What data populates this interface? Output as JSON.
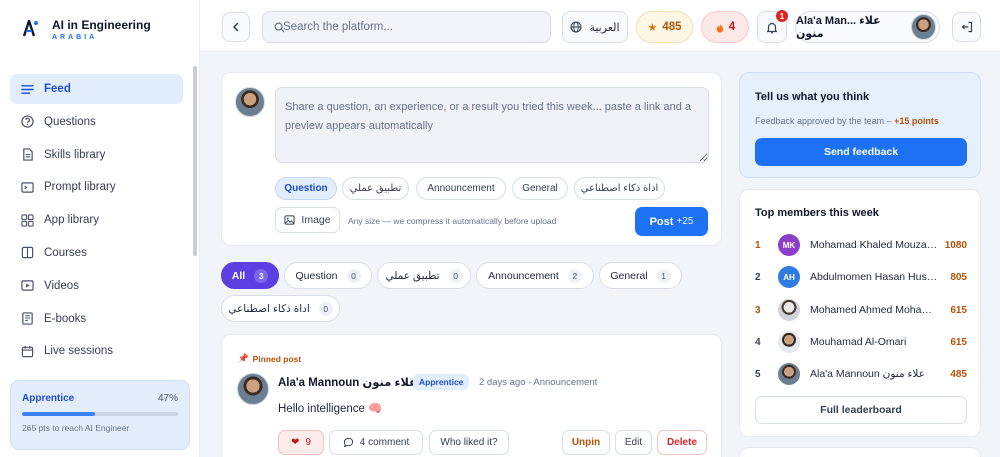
{
  "app": {
    "title": "AI in Engineering",
    "subtitle": "ARABIA"
  },
  "sidebar": {
    "items": [
      {
        "label": "Feed",
        "icon": "feed-icon",
        "active": true
      },
      {
        "label": "Questions",
        "icon": "question-icon"
      },
      {
        "label": "Skills library",
        "icon": "document-icon"
      },
      {
        "label": "Prompt library",
        "icon": "terminal-icon"
      },
      {
        "label": "App library",
        "icon": "apps-icon"
      },
      {
        "label": "Courses",
        "icon": "book-icon"
      },
      {
        "label": "Videos",
        "icon": "video-icon"
      },
      {
        "label": "E-books",
        "icon": "ebook-icon"
      },
      {
        "label": "Live sessions",
        "icon": "calendar-icon"
      }
    ],
    "progress": {
      "level": "Apprentice",
      "percent": "47%",
      "fraction": 0.47,
      "note": "265 pts to reach AI Engineer"
    }
  },
  "topbar": {
    "search_placeholder": "Search the platform...",
    "language": "العربية",
    "points": "485",
    "streak": "4",
    "notifications": "1",
    "user_name": "Ala'a Man... علاء منون"
  },
  "composer": {
    "placeholder": "Share a question, an experience, or a result you tried this week... paste a link and a preview appears automatically",
    "categories": [
      "Question",
      "تطبيق عملي",
      "Announcement",
      "General",
      "اداة ذكاء اصطناعي"
    ],
    "image_label": "Image",
    "upload_note": "Any size — we compress it automatically before upload",
    "post_label": "Post",
    "post_points": "+25"
  },
  "filters": [
    {
      "label": "All",
      "count": "3",
      "active": true
    },
    {
      "label": "Question",
      "count": "0"
    },
    {
      "label": "تطبيق عملي",
      "count": "0"
    },
    {
      "label": "Announcement",
      "count": "2"
    },
    {
      "label": "General",
      "count": "1"
    },
    {
      "label": "اداة ذكاء اصطناعي",
      "count": "0"
    }
  ],
  "post": {
    "pinned_label": "Pinned post",
    "author": "Ala'a Mannoun علاء منون",
    "badge": "Apprentice",
    "meta": "2 days ago · Announcement",
    "body": "Hello intelligence 🧠",
    "likes": "9",
    "comments": "4  comment",
    "who_liked": "Who liked it?",
    "unpin": "Unpin",
    "edit": "Edit",
    "delete": "Delete"
  },
  "feedback": {
    "title": "Tell us what you think",
    "note": "Feedback approved by the team –",
    "points": "+15 points",
    "button": "Send feedback"
  },
  "top_members": {
    "title": "Top members this week",
    "members": [
      {
        "rank": "1",
        "initials": "MK",
        "color": "#8b3fc8",
        "name": "Mohamad Khaled Mouzayek",
        "points": "1080"
      },
      {
        "rank": "2",
        "initials": "AH",
        "color": "#2f7de1",
        "name": "Abdulmomen Hasan Hussein",
        "points": "805"
      },
      {
        "rank": "3",
        "initials": "",
        "color": "#9aa5b1",
        "name": "Mohamed Ahmed Mohammed",
        "points": "615"
      },
      {
        "rank": "4",
        "initials": "",
        "color": "#6b7f92",
        "name": "Mouhamad Al-Omari",
        "points": "615"
      },
      {
        "rank": "5",
        "initials": "",
        "color": "#6b7f92",
        "name": "Ala'a Mannoun علاء منون",
        "points": "485"
      }
    ],
    "leaderboard_button": "Full leaderboard"
  }
}
